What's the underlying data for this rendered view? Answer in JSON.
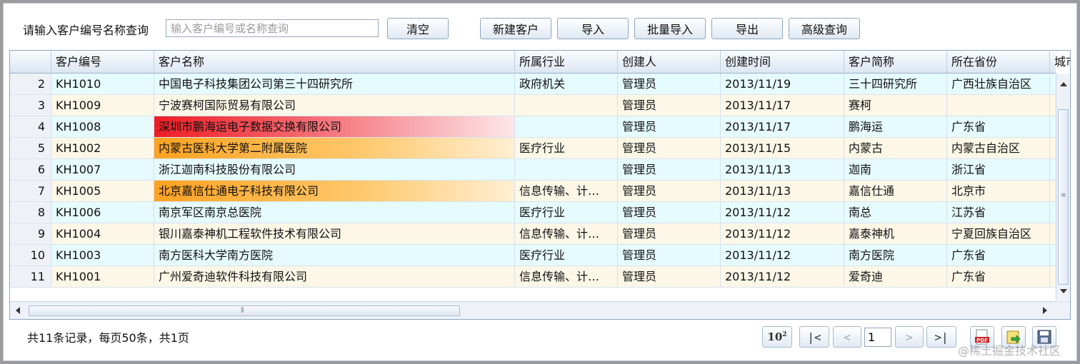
{
  "toolbar": {
    "search_label": "请输入客户编号名称查询",
    "search_placeholder": "输入客户编号或名称查询",
    "clear_label": "清空",
    "new_label": "新建客户",
    "import_label": "导入",
    "batch_import_label": "批量导入",
    "export_label": "导出",
    "advanced_label": "高级查询"
  },
  "grid": {
    "columns": [
      "",
      "客户编号",
      "客户名称",
      "所属行业",
      "创建人",
      "创建时间",
      "客户简称",
      "所在省份",
      "城市"
    ],
    "rows": [
      {
        "n": "2",
        "code": "KH1010",
        "name": "中国电子科技集团公司第三十四研究所",
        "industry": "政府机关",
        "creator": "管理员",
        "date": "2013/11/19",
        "short": "三十四研究所",
        "prov": "广西壮族自治区",
        "hl": ""
      },
      {
        "n": "3",
        "code": "KH1009",
        "name": "宁波赛柯国际贸易有限公司",
        "industry": "",
        "creator": "管理员",
        "date": "2013/11/17",
        "short": "赛柯",
        "prov": "",
        "hl": ""
      },
      {
        "n": "4",
        "code": "KH1008",
        "name": "深圳市鹏海运电子数据交换有限公司",
        "industry": "",
        "creator": "管理员",
        "date": "2013/11/17",
        "short": "鹏海运",
        "prov": "广东省",
        "hl": "red"
      },
      {
        "n": "5",
        "code": "KH1002",
        "name": "内蒙古医科大学第二附属医院",
        "industry": "医疗行业",
        "creator": "管理员",
        "date": "2013/11/15",
        "short": "内蒙古",
        "prov": "内蒙古自治区",
        "hl": "orange"
      },
      {
        "n": "6",
        "code": "KH1007",
        "name": "浙江迦南科技股份有限公司",
        "industry": "",
        "creator": "管理员",
        "date": "2013/11/13",
        "short": "迦南",
        "prov": "浙江省",
        "hl": ""
      },
      {
        "n": "7",
        "code": "KH1005",
        "name": "北京嘉信仕通电子科技有限公司",
        "industry": "信息传输、计…",
        "creator": "管理员",
        "date": "2013/11/13",
        "short": "嘉信仕通",
        "prov": "北京市",
        "hl": "orange"
      },
      {
        "n": "8",
        "code": "KH1006",
        "name": "南京军区南京总医院",
        "industry": "医疗行业",
        "creator": "管理员",
        "date": "2013/11/12",
        "short": "南总",
        "prov": "江苏省",
        "hl": ""
      },
      {
        "n": "9",
        "code": "KH1004",
        "name": "银川嘉泰神机工程软件技术有限公司",
        "industry": "信息传输、计…",
        "creator": "管理员",
        "date": "2013/11/12",
        "short": "嘉泰神机",
        "prov": "宁夏回族自治区",
        "hl": ""
      },
      {
        "n": "10",
        "code": "KH1003",
        "name": "南方医科大学南方医院",
        "industry": "医疗行业",
        "creator": "管理员",
        "date": "2013/11/12",
        "short": "南方医院",
        "prov": "广东省",
        "hl": ""
      },
      {
        "n": "11",
        "code": "KH1001",
        "name": "广州爱奇迪软件科技有限公司",
        "industry": "信息传输、计…",
        "creator": "管理员",
        "date": "2013/11/12",
        "short": "爱奇迪",
        "prov": "广东省",
        "hl": ""
      }
    ],
    "selected_row": "11"
  },
  "footer": {
    "summary": "共11条记录，每页50条，共1页",
    "page_size_icon": "10",
    "page_size_sup": "2",
    "first_label": "|<",
    "prev_label": "<",
    "page_value": "1",
    "next_label": ">",
    "last_label": ">|",
    "pdf_label": "PDF"
  },
  "watermark": "@稀土掘金技术社区",
  "colors": {
    "accent_border": "#8fa5c0",
    "row_odd": "#e6fbfd",
    "row_even": "#fdf7e8",
    "highlight_red": "#ee1c24",
    "highlight_orange": "#ffa322"
  },
  "icons": [
    "pagesize-icon",
    "pdf-export-icon",
    "export-icon",
    "save-icon",
    "chevron-up-icon",
    "chevron-down-icon",
    "chevron-left-icon",
    "chevron-right-icon"
  ]
}
